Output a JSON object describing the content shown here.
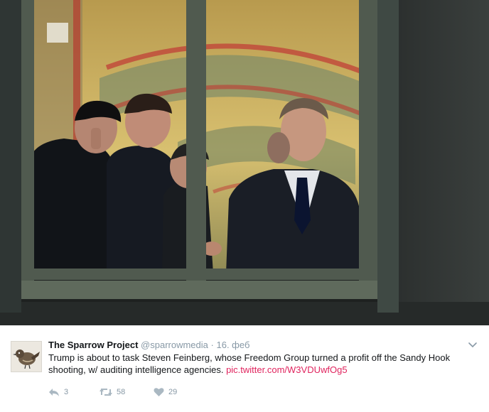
{
  "tweet": {
    "display_name": "The Sparrow Project",
    "handle": "@sparrowmedia",
    "separator": "·",
    "date": "16. феб",
    "text_before_link": "Trump is about to task Steven Feinberg, whose Freedom Group turned a profit off the Sandy Hook shooting, w/ auditing intelligence agencies. ",
    "link_text": "pic.twitter.com/W3VDUwfOg5",
    "link_color": "#e0245e",
    "actions": {
      "reply_count": "3",
      "retweet_count": "58",
      "like_count": "29"
    }
  },
  "icons": {
    "avatar": "sparrow-icon",
    "more": "chevron-down-icon",
    "reply": "reply-icon",
    "retweet": "retweet-icon",
    "like": "heart-icon"
  }
}
